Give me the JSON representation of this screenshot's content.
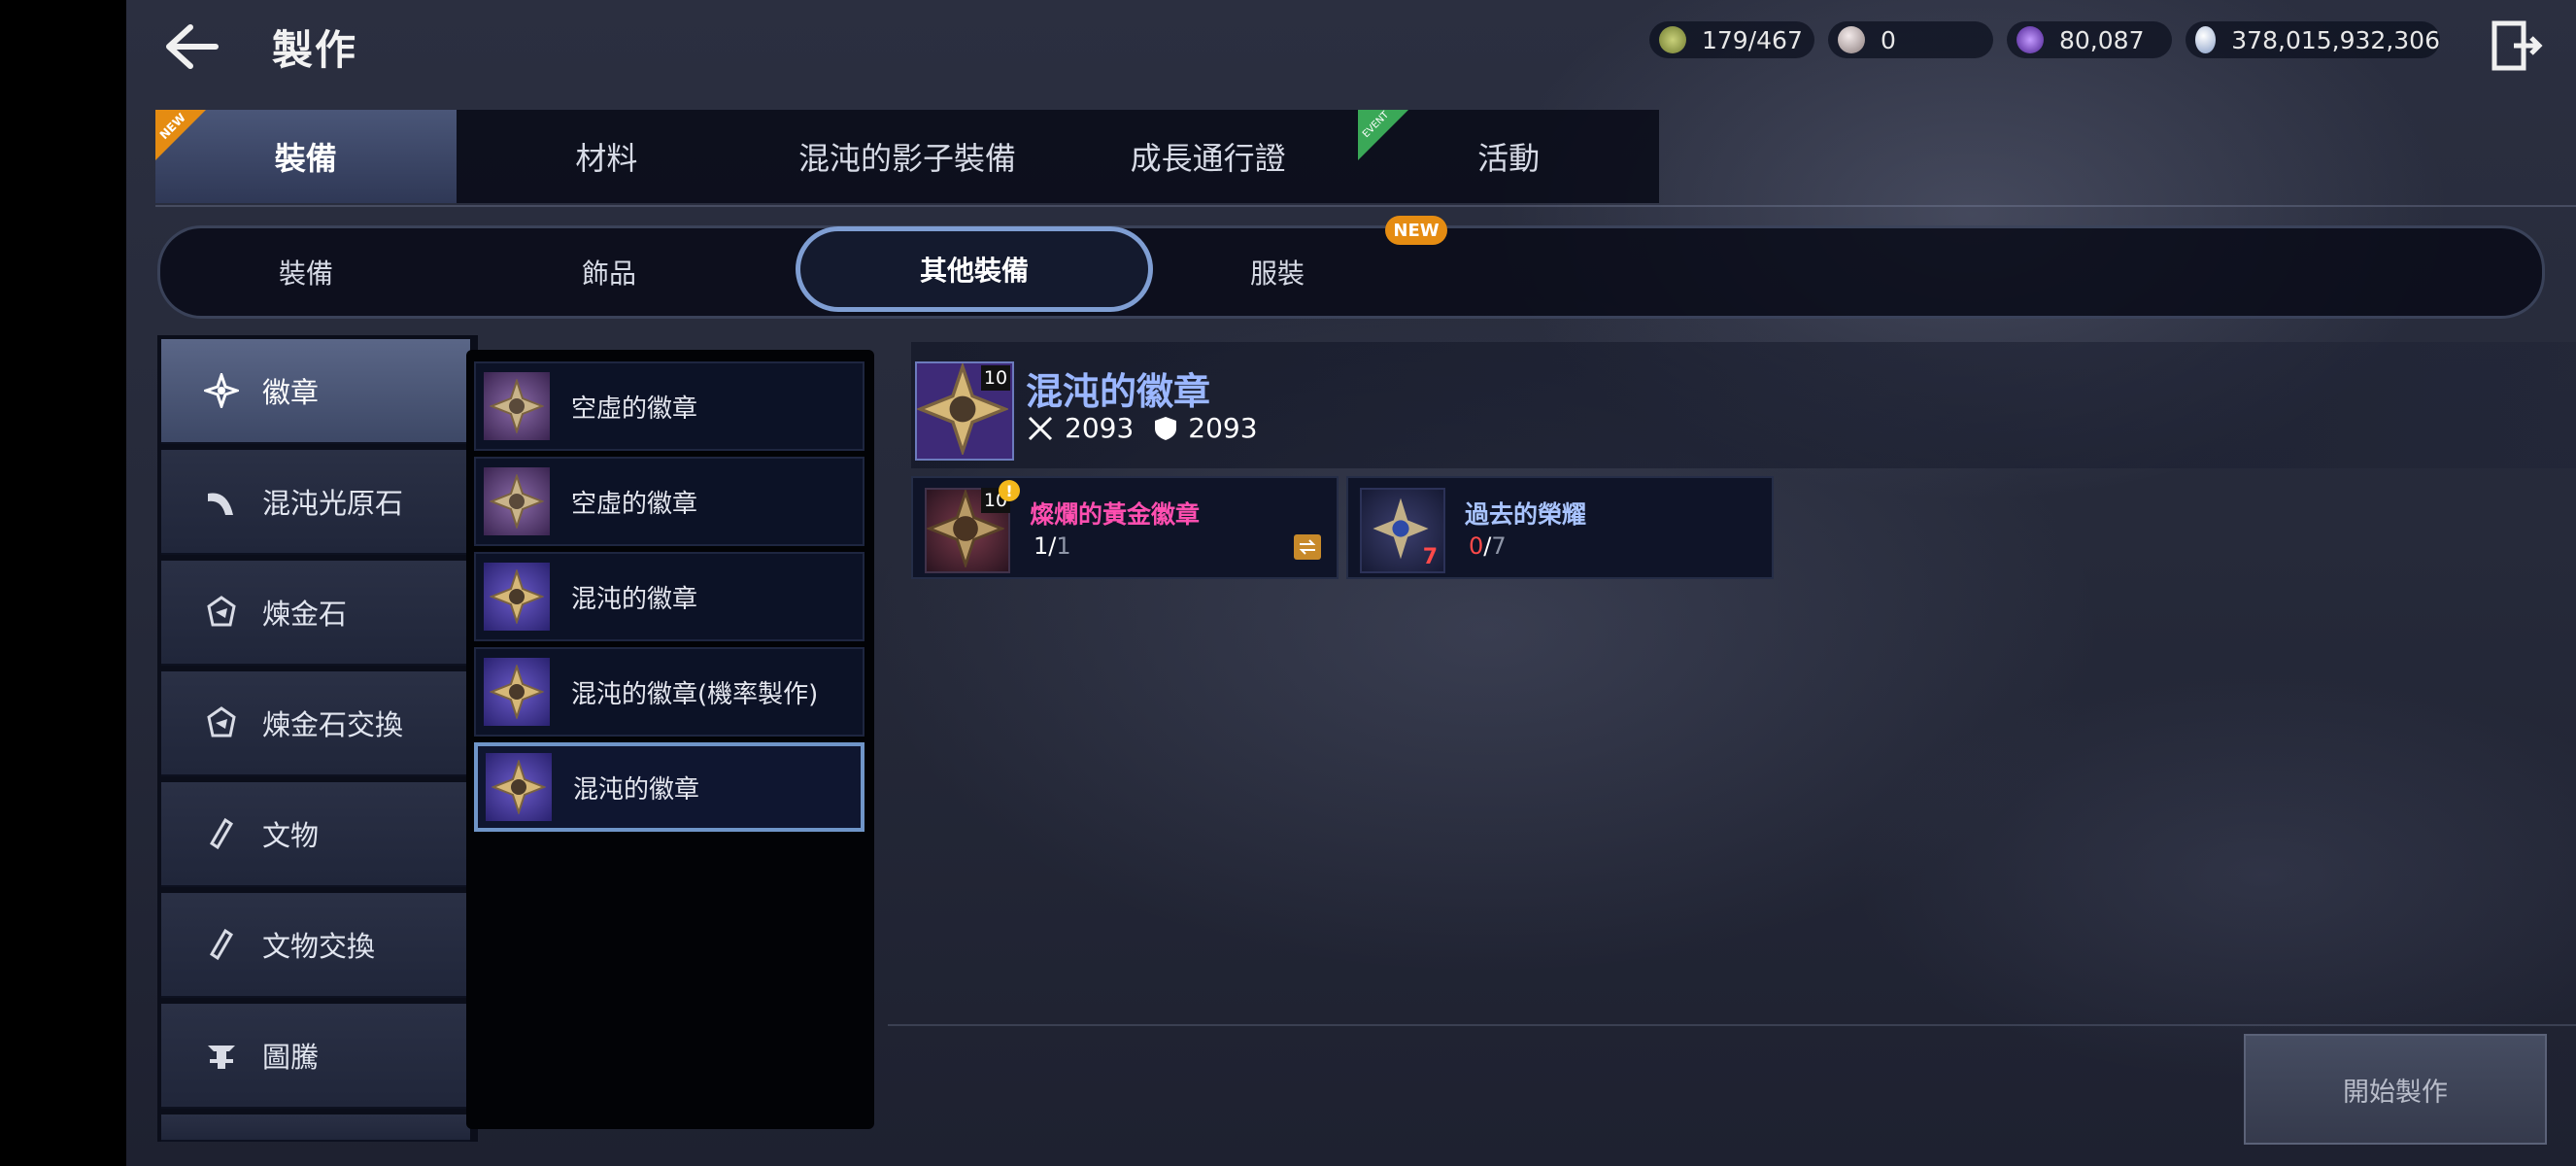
{
  "header": {
    "title": "製作",
    "resources": [
      {
        "icon": "stamina-icon",
        "value": "179/467"
      },
      {
        "icon": "pearl-icon",
        "value": "0"
      },
      {
        "icon": "dark-crystal-icon",
        "value": "80,087"
      },
      {
        "icon": "silver-coin-icon",
        "value": "378,015,932,306"
      }
    ]
  },
  "main_tabs": [
    {
      "label": "裝備",
      "badge": "NEW",
      "active": true
    },
    {
      "label": "材料"
    },
    {
      "label": "混沌的影子裝備"
    },
    {
      "label": "成長通行證"
    },
    {
      "label": "活動",
      "badge": "EVENT"
    }
  ],
  "sub_tabs": [
    {
      "label": "裝備"
    },
    {
      "label": "飾品"
    },
    {
      "label": "其他裝備",
      "active": true
    },
    {
      "label": "服裝"
    }
  ],
  "sub_tab_badge": "NEW",
  "categories": [
    {
      "label": "徽章",
      "icon": "emblem-icon",
      "active": true
    },
    {
      "label": "混沌光原石",
      "icon": "crescent-icon"
    },
    {
      "label": "煉金石",
      "icon": "alchemy-stone-icon"
    },
    {
      "label": "煉金石交換",
      "icon": "alchemy-exchange-icon"
    },
    {
      "label": "文物",
      "icon": "artifact-icon"
    },
    {
      "label": "文物交換",
      "icon": "artifact-exchange-icon"
    },
    {
      "label": "圖騰",
      "icon": "totem-icon"
    }
  ],
  "recipes": [
    {
      "label": "空虛的徽章"
    },
    {
      "label": "空虛的徽章"
    },
    {
      "label": "混沌的徽章"
    },
    {
      "label": "混沌的徽章(機率製作)"
    },
    {
      "label": "混沌的徽章",
      "selected": true
    }
  ],
  "detail": {
    "name": "混沌的徽章",
    "level": "10",
    "attack": "2093",
    "defense": "2093",
    "materials": [
      {
        "name": "燦爛的黃金徽章",
        "level": "10",
        "have": "1",
        "need": "1",
        "name_color": "#ff4fb0"
      },
      {
        "name": "過去的榮耀",
        "have": "0",
        "need": "7",
        "badge": "7",
        "name_color": "#a9c4ff"
      }
    ]
  },
  "start_button": "開始製作",
  "colors": {
    "accent": "#7f9ed3",
    "name_blue": "#9bb7ff",
    "new_orange": "#e58c12",
    "event_green": "#3aa857"
  }
}
